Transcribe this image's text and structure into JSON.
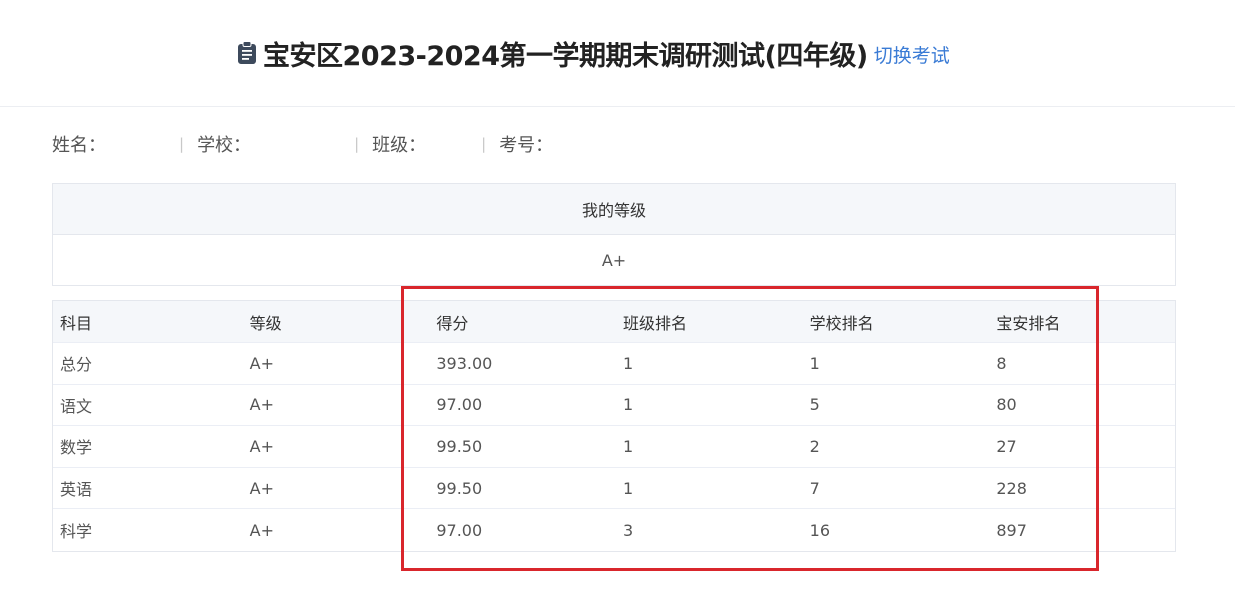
{
  "header": {
    "title": "宝安区2023-2024第一学期期末调研测试(四年级)",
    "switch_label": "切换考试",
    "icon": "document-icon"
  },
  "student_info": {
    "name_label": "姓名：",
    "school_label": "学校：",
    "class_label": "班级：",
    "exam_no_label": "考号：",
    "separator": "|"
  },
  "grade_summary": {
    "header": "我的等级",
    "value": "A+"
  },
  "score_table": {
    "columns": [
      "科目",
      "等级",
      "得分",
      "班级排名",
      "学校排名",
      "宝安排名"
    ],
    "rows": [
      [
        "总分",
        "A+",
        "393.00",
        "1",
        "1",
        "8"
      ],
      [
        "语文",
        "A+",
        "97.00",
        "1",
        "5",
        "80"
      ],
      [
        "数学",
        "A+",
        "99.50",
        "1",
        "2",
        "27"
      ],
      [
        "英语",
        "A+",
        "99.50",
        "1",
        "7",
        "228"
      ],
      [
        "科学",
        "A+",
        "97.00",
        "3",
        "16",
        "897"
      ]
    ]
  },
  "colors": {
    "link": "#3a7bd5",
    "highlight_border": "#d9262c",
    "table_header_bg": "#f5f7fa"
  }
}
